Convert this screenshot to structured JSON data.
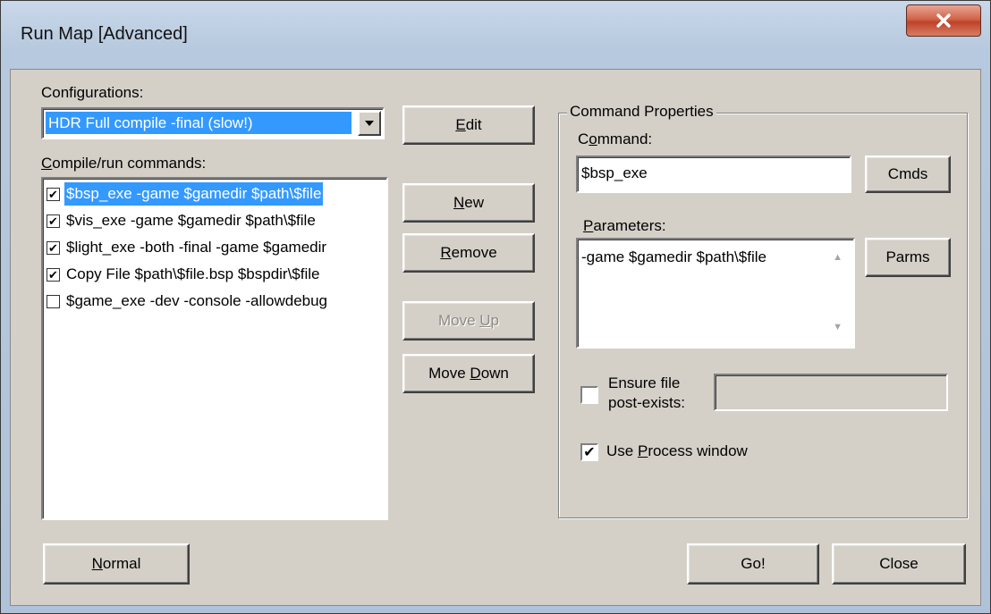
{
  "window": {
    "title": "Run Map [Advanced]",
    "close_icon": "close-icon"
  },
  "configurations": {
    "label": "Configurations:",
    "selected": "HDR Full compile -final (slow!)"
  },
  "commands": {
    "label": "Compile/run commands:",
    "items": [
      {
        "checked": true,
        "text": "$bsp_exe -game $gamedir $path\\$file",
        "selected": true
      },
      {
        "checked": true,
        "text": "$vis_exe -game $gamedir $path\\$file",
        "selected": false
      },
      {
        "checked": true,
        "text": "$light_exe -both -final -game $gamedir",
        "selected": false
      },
      {
        "checked": true,
        "text": "Copy File $path\\$file.bsp $bspdir\\$file",
        "selected": false
      },
      {
        "checked": false,
        "text": "$game_exe -dev -console -allowdebug",
        "selected": false
      }
    ]
  },
  "buttons": {
    "edit": "Edit",
    "new": "New",
    "remove": "Remove",
    "move_up": "Move Up",
    "move_down": "Move Down",
    "normal": "Normal",
    "go": "Go!",
    "close": "Close",
    "cmds": "Cmds",
    "parms": "Parms"
  },
  "properties": {
    "group_title": "Command Properties",
    "command_label": "Command:",
    "command_value": "$bsp_exe",
    "parameters_label": "Parameters:",
    "parameters_value": "-game $gamedir $path\\$file",
    "ensure_label_line1": "Ensure file",
    "ensure_label_line2": "post-exists:",
    "ensure_checked": false,
    "ensure_value": "",
    "process_window_label": "Use Process window",
    "process_window_checked": true
  }
}
